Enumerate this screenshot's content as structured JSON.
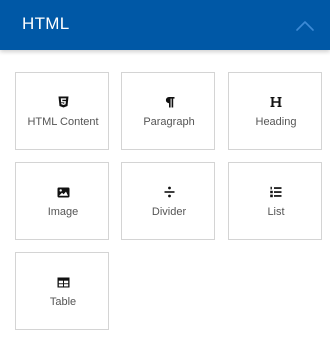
{
  "header": {
    "title": "HTML",
    "background_color": "#0058a6",
    "toggle_icon": "chevron-up-icon"
  },
  "blocks": [
    {
      "label": "HTML Content",
      "icon": "html5-icon"
    },
    {
      "label": "Paragraph",
      "icon": "pilcrow-icon"
    },
    {
      "label": "Heading",
      "icon": "heading-icon"
    },
    {
      "label": "Image",
      "icon": "image-icon"
    },
    {
      "label": "Divider",
      "icon": "divide-icon"
    },
    {
      "label": "List",
      "icon": "list-ol-icon"
    },
    {
      "label": "Table",
      "icon": "table-icon"
    }
  ]
}
